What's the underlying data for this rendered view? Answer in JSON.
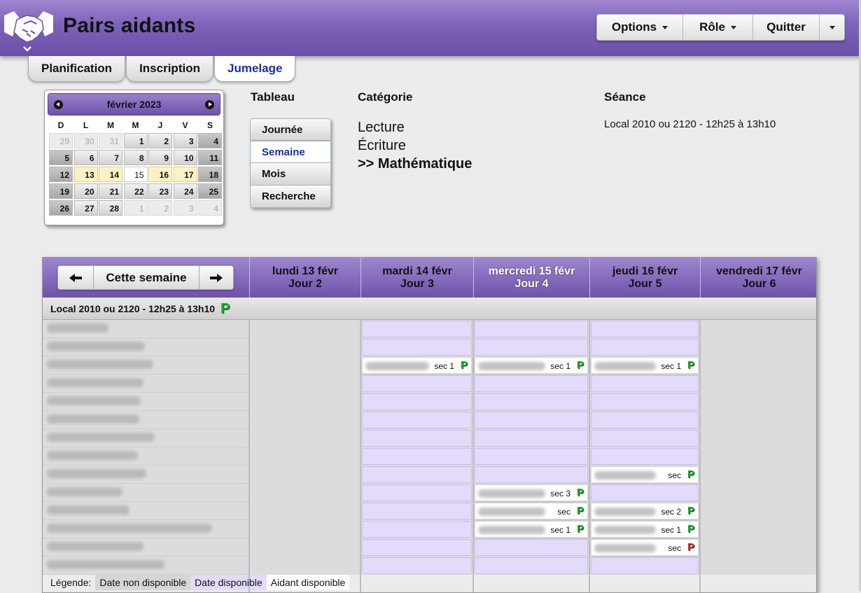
{
  "header": {
    "title": "Pairs aidants",
    "menu": [
      {
        "label": "Options",
        "has_caret": true
      },
      {
        "label": "Rôle",
        "has_caret": true
      },
      {
        "label": "Quitter",
        "has_caret": false
      }
    ]
  },
  "tabs": [
    {
      "label": "Planification",
      "active": false
    },
    {
      "label": "Inscription",
      "active": false
    },
    {
      "label": "Jumelage",
      "active": true
    }
  ],
  "calendar": {
    "month_label": "février 2023",
    "weekdays": [
      "D",
      "L",
      "M",
      "M",
      "J",
      "V",
      "S"
    ],
    "days": [
      {
        "n": "29",
        "kind": "other"
      },
      {
        "n": "30",
        "kind": "other"
      },
      {
        "n": "31",
        "kind": "other"
      },
      {
        "n": "1",
        "kind": "normal"
      },
      {
        "n": "2",
        "kind": "normal"
      },
      {
        "n": "3",
        "kind": "normal"
      },
      {
        "n": "4",
        "kind": "weekend"
      },
      {
        "n": "5",
        "kind": "weekend"
      },
      {
        "n": "6",
        "kind": "normal"
      },
      {
        "n": "7",
        "kind": "normal"
      },
      {
        "n": "8",
        "kind": "normal"
      },
      {
        "n": "9",
        "kind": "normal"
      },
      {
        "n": "10",
        "kind": "normal"
      },
      {
        "n": "11",
        "kind": "weekend"
      },
      {
        "n": "12",
        "kind": "weekend"
      },
      {
        "n": "13",
        "kind": "week"
      },
      {
        "n": "14",
        "kind": "week"
      },
      {
        "n": "15",
        "kind": "today"
      },
      {
        "n": "16",
        "kind": "week"
      },
      {
        "n": "17",
        "kind": "week"
      },
      {
        "n": "18",
        "kind": "weekend"
      },
      {
        "n": "19",
        "kind": "weekend"
      },
      {
        "n": "20",
        "kind": "normal"
      },
      {
        "n": "21",
        "kind": "normal"
      },
      {
        "n": "22",
        "kind": "normal"
      },
      {
        "n": "23",
        "kind": "normal"
      },
      {
        "n": "24",
        "kind": "normal"
      },
      {
        "n": "25",
        "kind": "weekend"
      },
      {
        "n": "26",
        "kind": "weekend"
      },
      {
        "n": "27",
        "kind": "normal"
      },
      {
        "n": "28",
        "kind": "normal"
      },
      {
        "n": "1",
        "kind": "other"
      },
      {
        "n": "2",
        "kind": "other"
      },
      {
        "n": "3",
        "kind": "other"
      },
      {
        "n": "4",
        "kind": "other"
      }
    ]
  },
  "tableau": {
    "title": "Tableau",
    "options": [
      {
        "label": "Journée",
        "active": false
      },
      {
        "label": "Semaine",
        "active": true
      },
      {
        "label": "Mois",
        "active": false
      },
      {
        "label": "Recherche",
        "active": false
      }
    ]
  },
  "categorie": {
    "title": "Catégorie",
    "items": [
      {
        "label": "Lecture",
        "active": false
      },
      {
        "label": "Écriture",
        "active": false
      },
      {
        "label": ">> Mathématique",
        "active": true
      }
    ]
  },
  "seance": {
    "title": "Séance",
    "value": "Local 2010 ou 2120 - 12h25 à 13h10"
  },
  "schedule": {
    "nav": {
      "this_week_label": "Cette semaine"
    },
    "days": [
      {
        "date": "lundi 13 févr",
        "jour": "Jour 2",
        "today": false
      },
      {
        "date": "mardi 14 févr",
        "jour": "Jour 3",
        "today": false
      },
      {
        "date": "mercredi 15 févr",
        "jour": "Jour 4",
        "today": true
      },
      {
        "date": "jeudi 16 févr",
        "jour": "Jour 5",
        "today": false
      },
      {
        "date": "vendredi 17 févr",
        "jour": "Jour 6",
        "today": false
      }
    ],
    "group_label": "Local 2010 ou 2120 - 12h25 à 13h10",
    "group_badge": "P",
    "row_count": 14,
    "assignments": [
      {
        "day": 1,
        "row": 2,
        "sec": "sec 1",
        "badge": "green"
      },
      {
        "day": 2,
        "row": 2,
        "sec": "sec 1",
        "badge": "green"
      },
      {
        "day": 3,
        "row": 2,
        "sec": "sec 1",
        "badge": "green"
      },
      {
        "day": 3,
        "row": 8,
        "sec": "sec",
        "badge": "green"
      },
      {
        "day": 2,
        "row": 9,
        "sec": "sec 3",
        "badge": "green"
      },
      {
        "day": 2,
        "row": 10,
        "sec": "sec",
        "badge": "green"
      },
      {
        "day": 3,
        "row": 10,
        "sec": "sec 2",
        "badge": "green"
      },
      {
        "day": 2,
        "row": 11,
        "sec": "sec 1",
        "badge": "green"
      },
      {
        "day": 3,
        "row": 11,
        "sec": "sec 1",
        "badge": "green"
      },
      {
        "day": 3,
        "row": 12,
        "sec": "sec",
        "badge": "red"
      }
    ],
    "legend": {
      "label": "Légende:",
      "items": [
        "Date non disponible",
        "Date disponible",
        "Aidant disponible"
      ]
    }
  },
  "colors": {
    "brand_purple": "#7d62b9",
    "available_slot": "#e4dafc",
    "active_link": "#1b2ea8",
    "week_highlight": "#fdf2c6"
  },
  "icons": {
    "logo": "handshake-icon",
    "badge": "p-badge-icon"
  }
}
